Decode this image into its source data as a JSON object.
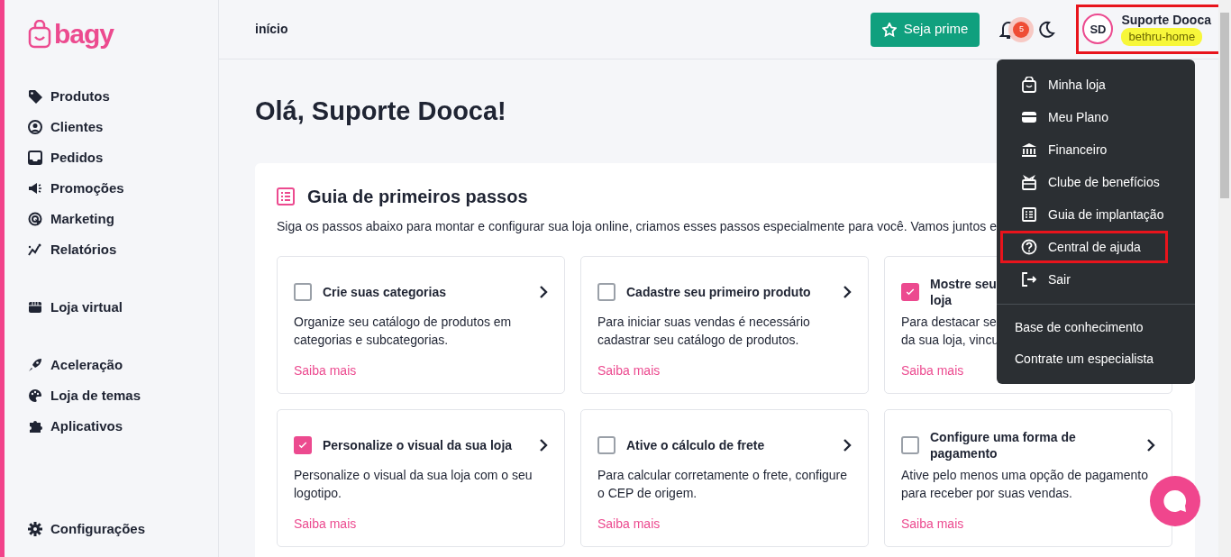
{
  "sidebar": {
    "logo": "bagy",
    "groups": [
      [
        {
          "label": "Produtos"
        },
        {
          "label": "Clientes"
        },
        {
          "label": "Pedidos"
        },
        {
          "label": "Promoções"
        },
        {
          "label": "Marketing"
        },
        {
          "label": "Relatórios"
        }
      ],
      [
        {
          "label": "Loja virtual"
        }
      ],
      [
        {
          "label": "Aceleração"
        },
        {
          "label": "Loja de temas"
        },
        {
          "label": "Aplicativos"
        }
      ]
    ],
    "footer_item": {
      "label": "Configurações"
    }
  },
  "header": {
    "breadcrumb": "início",
    "prime_button": "Seja prime",
    "notification_count": "5",
    "user": {
      "initials": "SD",
      "name": "Suporte Dooca",
      "store": "bethru-home",
      "highlighted": true
    }
  },
  "greeting": "Olá, Suporte Dooca!",
  "guide": {
    "title": "Guia de primeiros passos",
    "subtitle": "Siga os passos abaixo para montar e configurar sua loja online, criamos esses passos especialmente para você. Vamos juntos e",
    "steps": [
      {
        "title_lines": [
          "Crie suas categorias"
        ],
        "description_lines": [
          "Organize seu catálogo de produtos em",
          "categorias e subcategorias."
        ],
        "link": "Saiba mais",
        "checked": false,
        "chevron": true
      },
      {
        "title_lines": [
          "Cadastre seu primeiro produto"
        ],
        "description_lines": [
          "Para iniciar suas vendas é necessário",
          "cadastrar seu catálogo de produtos."
        ],
        "link": "Saiba mais",
        "checked": false,
        "chevron": true
      },
      {
        "title_lines": [
          "Mostre seu",
          "loja"
        ],
        "description_lines": [
          "Para destacar se",
          "da sua loja, vincu"
        ],
        "link": "Saiba mais",
        "checked": true
      },
      {
        "title_lines": [
          "Personalize o visual da sua loja"
        ],
        "description_lines": [
          "Personalize o visual da sua loja com o seu",
          "logotipo."
        ],
        "link": "Saiba mais",
        "checked": true,
        "chevron": true
      },
      {
        "title_lines": [
          "Ative o cálculo de frete"
        ],
        "description_lines": [
          "Para calcular corretamente o frete, configure",
          "o CEP de origem."
        ],
        "link": "Saiba mais",
        "checked": false,
        "chevron": true
      },
      {
        "title_lines": [
          "Configure uma forma de",
          "pagamento"
        ],
        "description_lines": [
          "Ative pelo menos uma opção de pagamento",
          "para receber por suas vendas."
        ],
        "link": "Saiba mais",
        "checked": false,
        "chevron": true
      }
    ]
  },
  "user_menu": {
    "items": [
      {
        "label": "Minha loja",
        "highlighted": false
      },
      {
        "label": "Meu Plano",
        "highlighted": false
      },
      {
        "label": "Financeiro",
        "highlighted": false
      },
      {
        "label": "Clube de benefícios",
        "highlighted": false
      },
      {
        "label": "Guia de implantação",
        "highlighted": false
      },
      {
        "label": "Central de ajuda",
        "highlighted": true
      },
      {
        "label": "Sair",
        "highlighted": false
      }
    ],
    "links": [
      "Base de conhecimento",
      "Contrate um especialista"
    ]
  }
}
